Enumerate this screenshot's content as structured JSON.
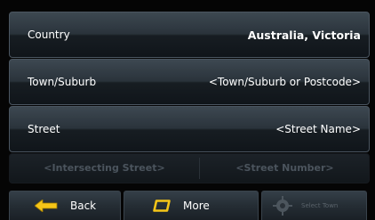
{
  "rows": {
    "country": {
      "label": "Country",
      "value": "Australia, Victoria"
    },
    "town": {
      "label": "Town/Suburb",
      "value": "<Town/Suburb or Postcode>"
    },
    "street": {
      "label": "Street",
      "value": "<Street Name>"
    }
  },
  "inactive": {
    "intersecting_street": "<Intersecting Street>",
    "street_number": "<Street Number>"
  },
  "bottombar": {
    "back_label": "Back",
    "more_label": "More",
    "select_town_label": "Select Town"
  },
  "icons": {
    "back": "back-arrow-icon",
    "more": "more-rectangle-icon",
    "select_town": "target-icon"
  },
  "colors": {
    "background": "#050505",
    "button_top": "#3d4851",
    "button_bottom": "#10151a",
    "back_arrow": "#f5c518",
    "more_icon": "#f5c518",
    "disabled_text": "#4b545d"
  }
}
